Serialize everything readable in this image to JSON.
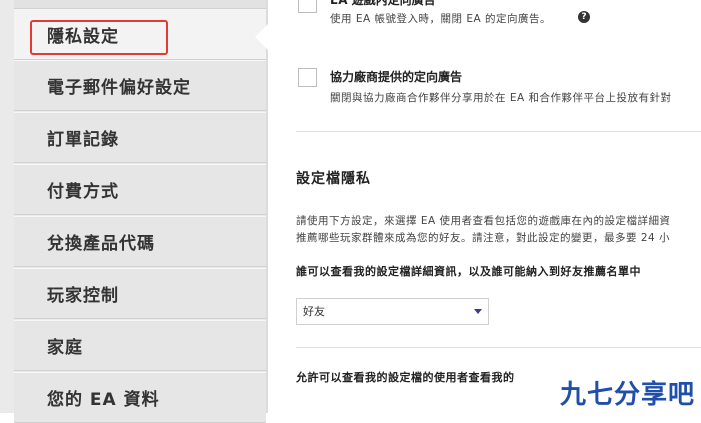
{
  "sidebar": {
    "items": [
      {
        "label": "隱私設定",
        "active": true
      },
      {
        "label": "電子郵件偏好設定"
      },
      {
        "label": "訂單記錄"
      },
      {
        "label": "付費方式"
      },
      {
        "label": "兌換產品代碼"
      },
      {
        "label": "玩家控制"
      },
      {
        "label": "家庭"
      },
      {
        "label": "您的 EA 資料"
      }
    ]
  },
  "options": [
    {
      "title": "EA 遊戲內定向廣告",
      "desc": "使用 EA 帳號登入時，關閉 EA 的定向廣告。",
      "checked": false
    },
    {
      "title": "協力廠商提供的定向廣告",
      "desc": "關閉與協力廠商合作夥伴分享用於在 EA 和合作夥伴平台上投放有針對",
      "checked": false
    }
  ],
  "profile": {
    "title": "設定檔隱私",
    "para1": "請使用下方設定，來選擇 EA 使用者查看包括您的遊戲庫在內的設定檔詳細資",
    "para2": "推薦哪些玩家群體來成為您的好友。請注意，對此設定的變更，最多要 24 小",
    "q1": "誰可以查看我的設定檔詳細資訊，以及誰可能納入到好友推薦名單中",
    "select_value": "好友",
    "q2": "允許可以查看我的設定檔的使用者查看我的"
  },
  "watermark": "九七分享吧",
  "colors": {
    "highlight": "#e53935",
    "caret": "#3b3a8f",
    "watermark": "#1f4fa8"
  }
}
